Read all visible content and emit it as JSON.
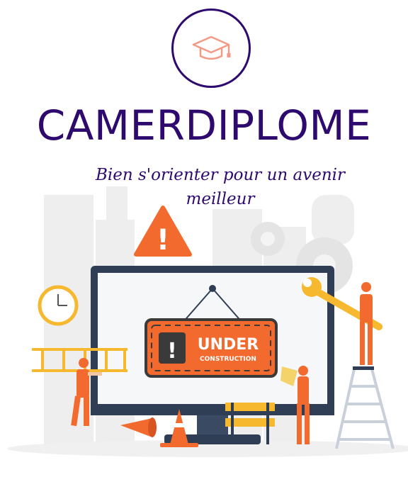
{
  "brand": {
    "name": "CAMERDIPLOME",
    "color": "#2e0a6f"
  },
  "tagline": {
    "line1": "Bien s'orienter pour un avenir",
    "line2": "meilleur"
  },
  "logo": {
    "icon": "graduation-cap-icon",
    "color": "#f29a86"
  },
  "illustration": {
    "sign_title": "UNDER",
    "sign_subtitle": "CONSTRUCTION",
    "sign_exclamation": "!",
    "warning_symbol": "!",
    "accent": "#f26a2e",
    "monitor_color": "#2f3e55"
  }
}
